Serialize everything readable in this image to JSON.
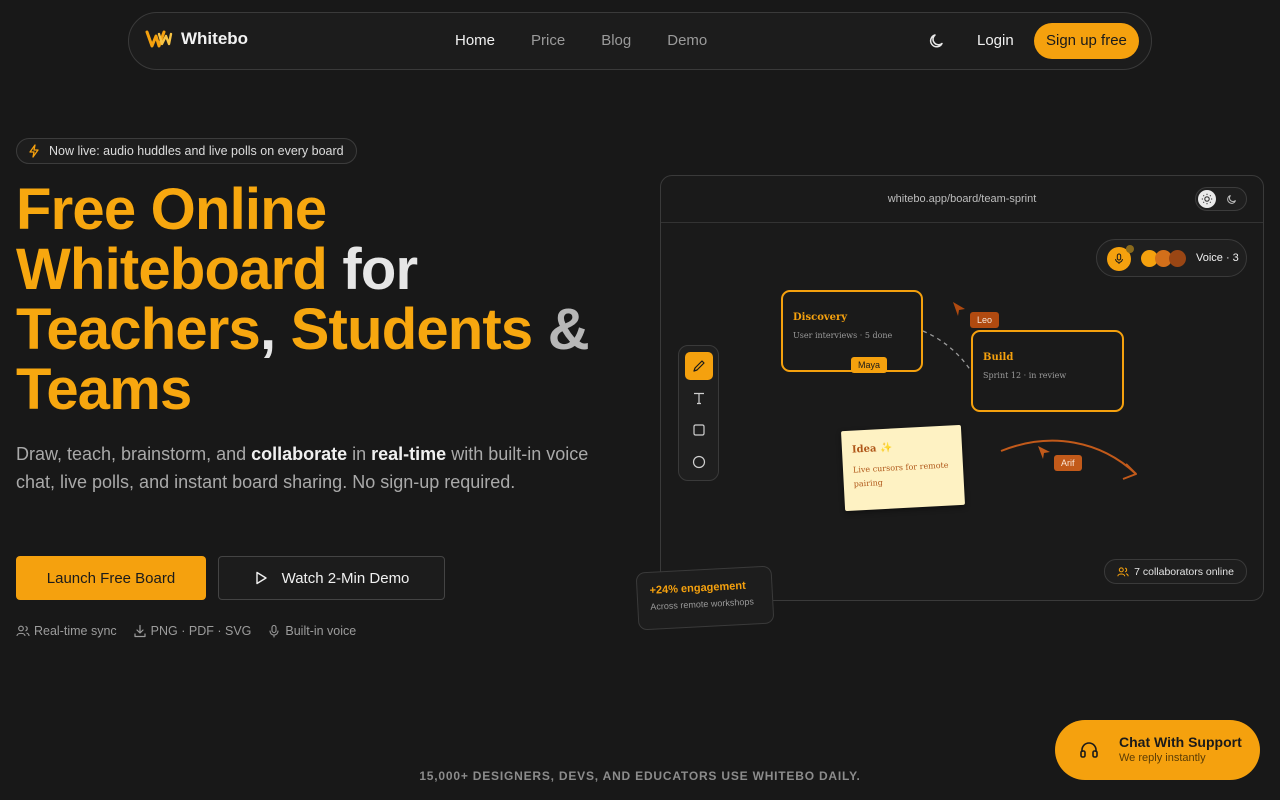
{
  "nav": {
    "brand": "Whitebo",
    "links": [
      {
        "label": "Home",
        "active": true
      },
      {
        "label": "Price",
        "active": false
      },
      {
        "label": "Blog",
        "active": false
      },
      {
        "label": "Demo",
        "active": false
      }
    ],
    "login": "Login",
    "signup": "Sign up free"
  },
  "announcement": "Now live: audio huddles and live polls on every board",
  "hero": {
    "headline": {
      "w1": "Free Online",
      "w2": "Whiteboard",
      "w3": "for",
      "w4": "Teachers",
      "w5": ",",
      "w6": "Students",
      "w7": "&",
      "w8": "Teams"
    },
    "lede": {
      "p1": "Draw, teach, brainstorm, and ",
      "b1": "collaborate",
      "p2": " in ",
      "b2": "real-time",
      "p3": " with built-in voice chat, live polls, and instant board sharing. No sign-up required."
    },
    "cta_primary": "Launch Free Board",
    "cta_secondary": "Watch 2-Min Demo",
    "features": [
      "Real-time sync",
      "PNG · PDF · SVG",
      "Built-in voice"
    ]
  },
  "board": {
    "url": "whitebo.app/board/team-sprint",
    "voice_label": "Voice · 3",
    "cards": [
      {
        "title": "Discovery",
        "sub": "User interviews · 5 done"
      },
      {
        "title": "Build",
        "sub": "Sprint 12 · in review"
      }
    ],
    "cursors": [
      "Maya",
      "Leo",
      "Arif"
    ],
    "sticky": {
      "title": "Idea ✨",
      "text": "Live cursors for remote pairing"
    },
    "collaborators": "7 collaborators online"
  },
  "engagement": {
    "title": "+24% engagement",
    "sub": "Across remote workshops"
  },
  "support": {
    "title": "Chat With Support",
    "sub": "We reply instantly"
  },
  "social_proof": "15,000+ DESIGNERS, DEVS, AND EDUCATORS USE WHITEBO DAILY.",
  "colors": {
    "accent": "#f5a10e",
    "background": "#181818"
  }
}
